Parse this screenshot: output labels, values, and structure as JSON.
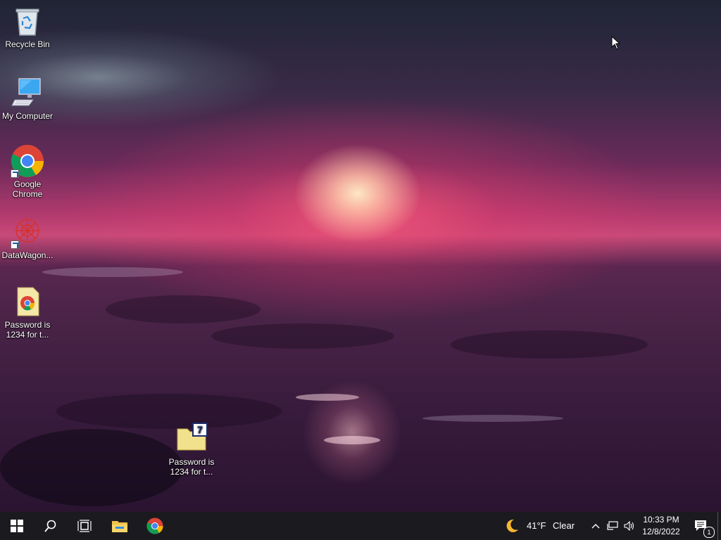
{
  "desktop_icons": [
    {
      "label": "Recycle Bin",
      "icon": "recycle-bin-icon"
    },
    {
      "label": "My Computer",
      "icon": "computer-icon"
    },
    {
      "label": "Google Chrome",
      "icon": "chrome-icon"
    },
    {
      "label": "DataWagon...",
      "icon": "datawagon-icon"
    },
    {
      "label": "Password is 1234 for t...",
      "icon": "archive-file-icon"
    },
    {
      "label": "Password is 1234 for t...",
      "icon": "7zip-archive-icon"
    }
  ],
  "taskbar": {
    "start": "windows-logo-icon",
    "search": "search-icon",
    "task_view": "task-view-icon",
    "pinned": [
      "file-explorer-icon",
      "chrome-icon"
    ],
    "weather": {
      "temp": "41°F",
      "condition": "Clear",
      "icon": "moon-icon"
    },
    "tray_icons": [
      "chevron-up-icon",
      "network-icon",
      "volume-icon"
    ],
    "time": "10:33 PM",
    "date": "12/8/2022",
    "notifications": {
      "count": "1",
      "icon": "notification-icon"
    }
  },
  "colors": {
    "taskbar_bg": "#1b1b1f",
    "sun": "#ffe9c4",
    "sky_glow": "#c84a78"
  }
}
